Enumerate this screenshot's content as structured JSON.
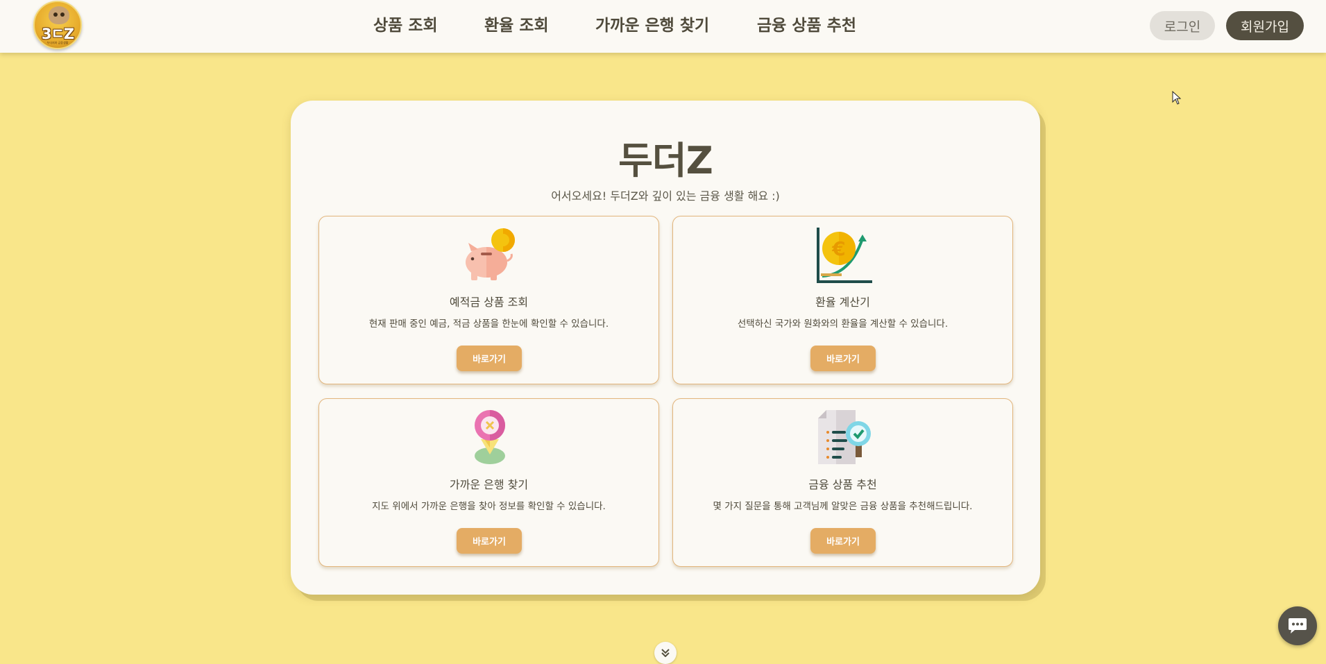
{
  "header": {
    "logo": {
      "brand": "3ㄷZ",
      "tagline": "두더지와 금융생활"
    },
    "nav": [
      {
        "label": "상품 조회"
      },
      {
        "label": "환율 조회"
      },
      {
        "label": "가까운 은행 찾기"
      },
      {
        "label": "금융 상품 추천"
      }
    ],
    "login_label": "로그인",
    "signup_label": "회원가입"
  },
  "main": {
    "title": "두더Z",
    "subtitle": "어서오세요! 두더Z와 깊이 있는 금융 생활 해요 :)",
    "features": [
      {
        "icon": "piggy-bank-icon",
        "title": "예적금 상품 조회",
        "description": "현재 판매 중인 예금, 적금 상품을 한눈에 확인할 수 있습니다.",
        "button": "바로가기"
      },
      {
        "icon": "exchange-chart-icon",
        "title": "환율 계산기",
        "description": "선택하신 국가와 원화와의 환율을 계산할 수 있습니다.",
        "button": "바로가기"
      },
      {
        "icon": "map-pin-icon",
        "title": "가까운 은행 찾기",
        "description": "지도 위에서 가까운 은행을 찾아 정보를 확인할 수 있습니다.",
        "button": "바로가기"
      },
      {
        "icon": "document-search-icon",
        "title": "금융 상품 추천",
        "description": "몇 가지 질문을 통해 고객님께 알맞은 금융 상품을 추천해드립니다.",
        "button": "바로가기"
      }
    ]
  },
  "colors": {
    "background": "#f9e68a",
    "card": "#fbf9f4",
    "accent_button": "#e4ac64",
    "dark": "#544f40"
  }
}
